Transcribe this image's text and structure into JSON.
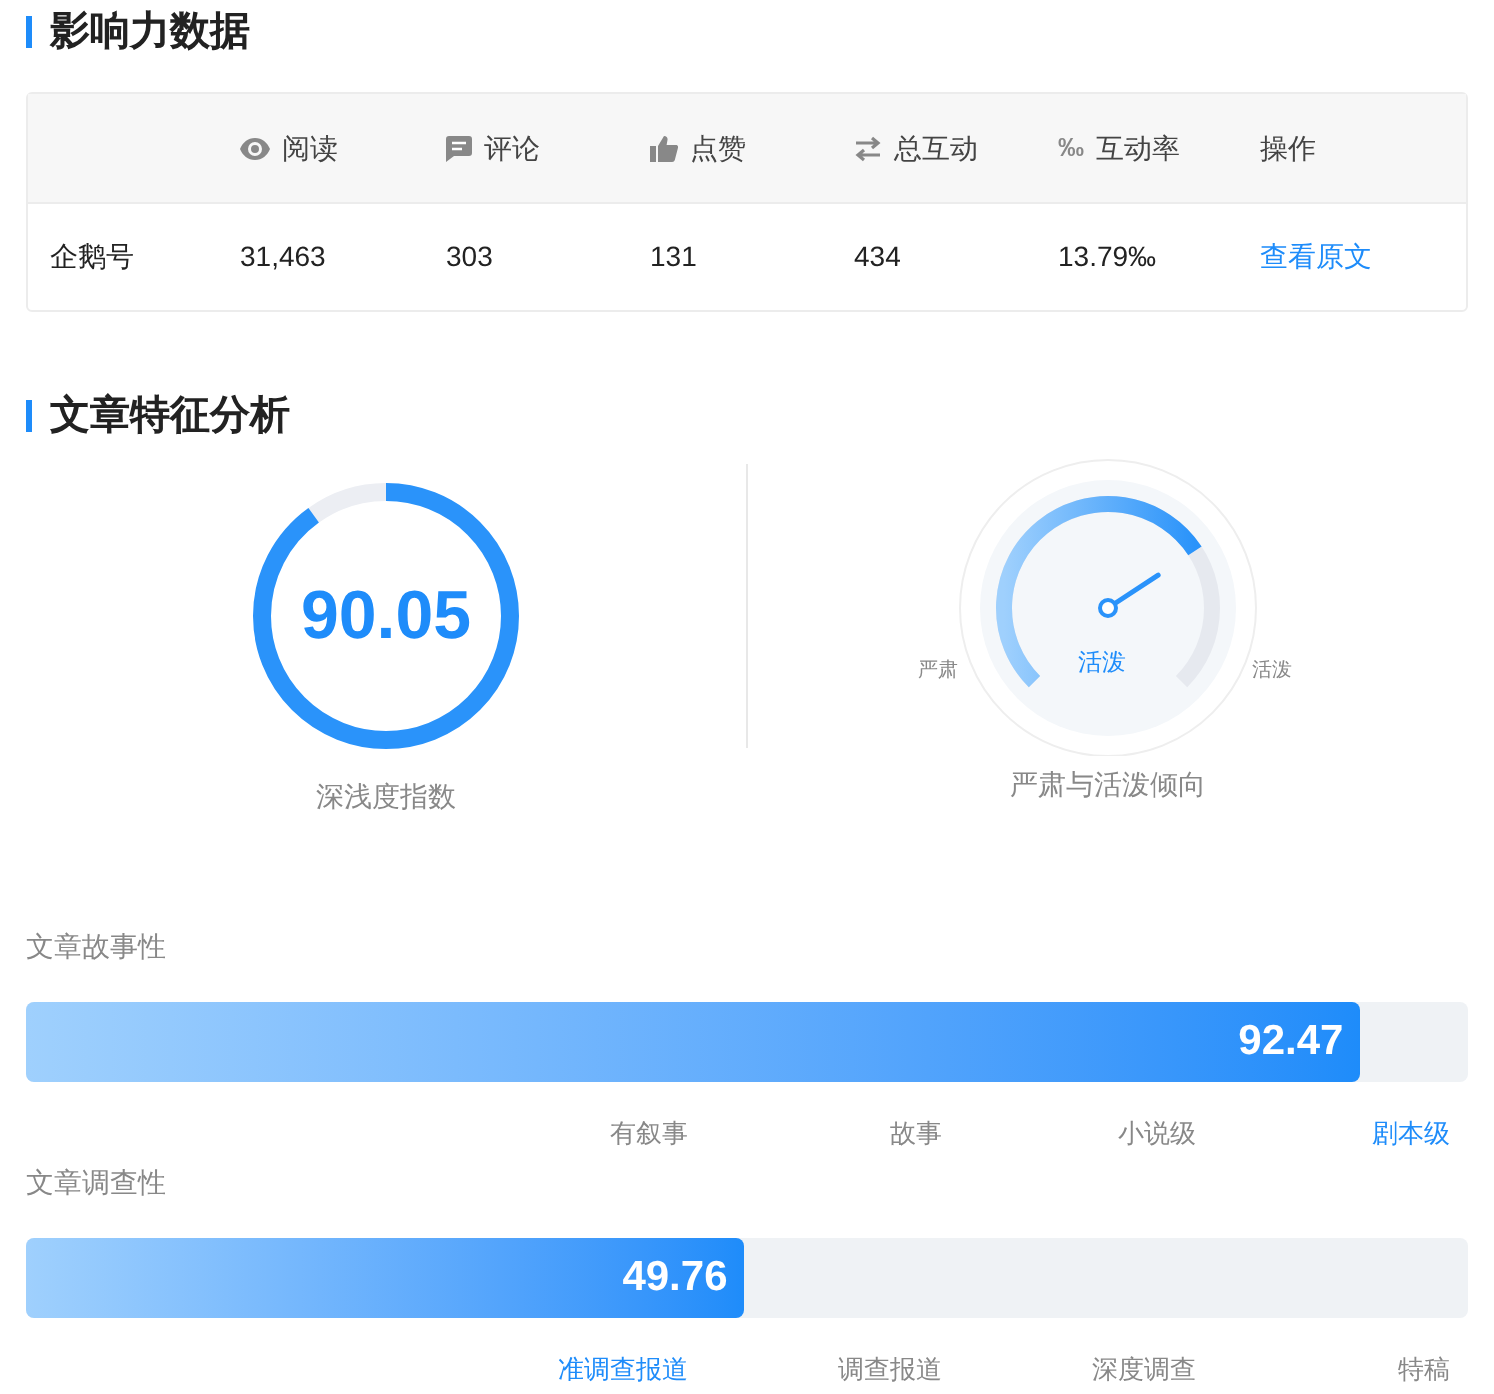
{
  "influence": {
    "title": "影响力数据",
    "columns": [
      {
        "kind": "blank"
      },
      {
        "label": "阅读",
        "kind": "eye"
      },
      {
        "label": "评论",
        "kind": "comment"
      },
      {
        "label": "点赞",
        "kind": "thumb"
      },
      {
        "label": "总互动",
        "kind": "swap"
      },
      {
        "label": "互动率",
        "kind": "glyph",
        "glyph": "‰"
      },
      {
        "label": "操作",
        "kind": "plain"
      }
    ],
    "rows": [
      {
        "cells": [
          "企鹅号",
          "31,463",
          "303",
          "131",
          "434",
          "13.79‰"
        ],
        "action": "查看原文"
      }
    ]
  },
  "features": {
    "title": "文章特征分析",
    "depth": {
      "value": "90.05",
      "level": 0.9005,
      "label": "深浅度指数"
    },
    "tone": {
      "reading": "活泼",
      "level": 0.71,
      "left": "严肃",
      "right": "活泼",
      "label": "严肃与活泼倾向"
    },
    "bars": [
      {
        "label": "文章故事性",
        "value": "92.47",
        "level": 0.9247,
        "ticks": [
          {
            "label": "有叙事",
            "selected": false
          },
          {
            "label": "故事",
            "selected": false
          },
          {
            "label": "小说级",
            "selected": false
          },
          {
            "label": "剧本级",
            "selected": true
          }
        ]
      },
      {
        "label": "文章调查性",
        "value": "49.76",
        "level": 0.4976,
        "ticks": [
          {
            "label": "准调查报道",
            "selected": true
          },
          {
            "label": "调查报道",
            "selected": false
          },
          {
            "label": "深度调查",
            "selected": false
          },
          {
            "label": "特稿",
            "selected": false
          }
        ]
      }
    ]
  }
}
